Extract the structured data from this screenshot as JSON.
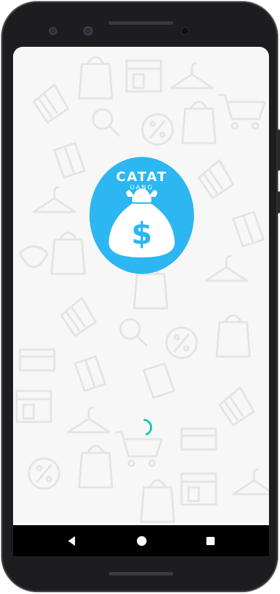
{
  "app": {
    "logo_title": "CATAT",
    "logo_subtitle": "UANG",
    "logo_symbol": "$",
    "brand_color": "#29b6f6"
  },
  "loading": {
    "spinner_color": "#19c7b3"
  },
  "nav": {
    "back_icon": "back-triangle-icon",
    "home_icon": "home-circle-icon",
    "recents_icon": "recents-square-icon"
  }
}
